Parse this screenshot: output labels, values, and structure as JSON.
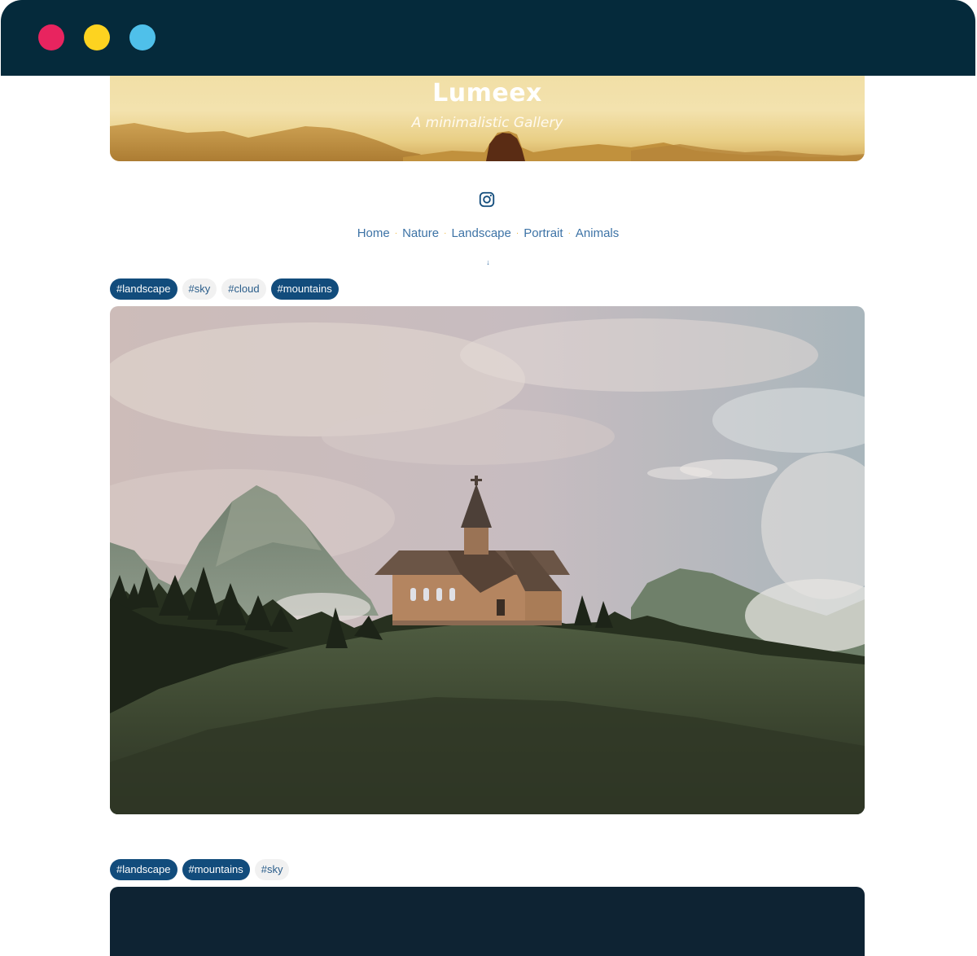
{
  "window": {
    "colors": {
      "bar": "#052a3b",
      "close": "#e8245f",
      "minimize": "#fdd320",
      "maximize": "#4fc0ea"
    }
  },
  "hero": {
    "title": "Lumeex",
    "subtitle": "A minimalistic Gallery"
  },
  "social": {
    "icon": "instagram-icon"
  },
  "nav": {
    "items": [
      {
        "label": "Home"
      },
      {
        "label": "Nature"
      },
      {
        "label": "Landscape"
      },
      {
        "label": "Portrait"
      },
      {
        "label": "Animals"
      }
    ],
    "separator": "·",
    "scroll_hint": "↓"
  },
  "gallery": [
    {
      "tags": [
        {
          "label": "#landscape",
          "active": true
        },
        {
          "label": "#sky",
          "active": false
        },
        {
          "label": "#cloud",
          "active": false
        },
        {
          "label": "#mountains",
          "active": true
        }
      ],
      "photo": "church-on-hill"
    },
    {
      "tags": [
        {
          "label": "#landscape",
          "active": true
        },
        {
          "label": "#mountains",
          "active": true
        },
        {
          "label": "#sky",
          "active": false
        }
      ],
      "photo": "dark-image"
    }
  ],
  "accent": "#124c7c"
}
